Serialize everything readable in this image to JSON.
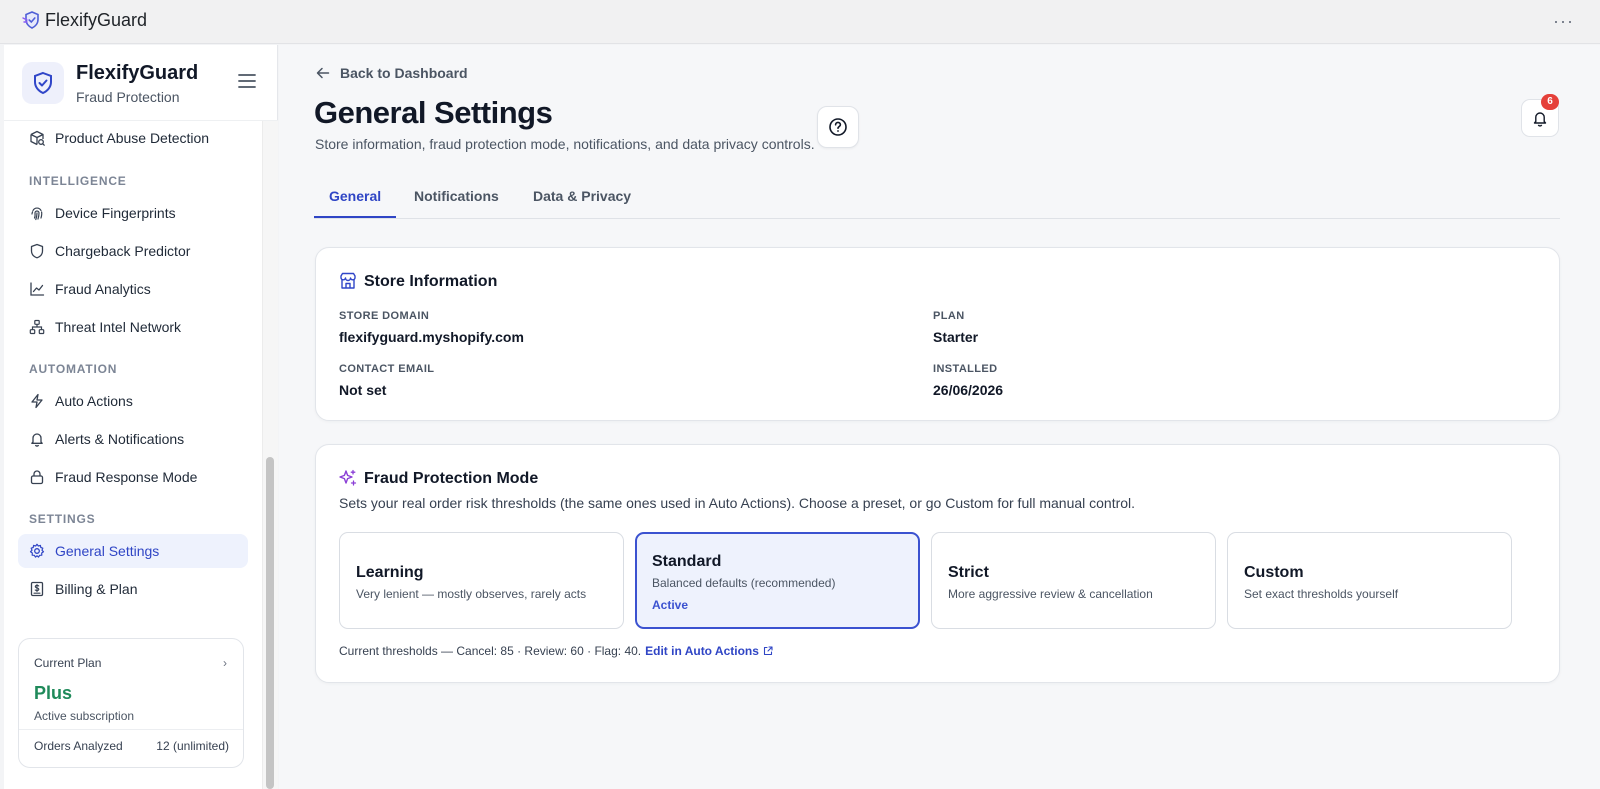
{
  "app": {
    "title": "FlexifyGuard",
    "more": "···"
  },
  "sidebar": {
    "brand": "FlexifyGuard",
    "subtitle": "Fraud Protection",
    "top_item": {
      "label": "Product Abuse Detection",
      "icon": "package-search-icon"
    },
    "sections": [
      {
        "title": "INTELLIGENCE",
        "items": [
          {
            "label": "Device Fingerprints",
            "icon": "fingerprint-icon"
          },
          {
            "label": "Chargeback Predictor",
            "icon": "shield-icon"
          },
          {
            "label": "Fraud Analytics",
            "icon": "line-chart-icon"
          },
          {
            "label": "Threat Intel Network",
            "icon": "network-icon"
          }
        ]
      },
      {
        "title": "AUTOMATION",
        "items": [
          {
            "label": "Auto Actions",
            "icon": "lightning-icon"
          },
          {
            "label": "Alerts & Notifications",
            "icon": "bell-icon"
          },
          {
            "label": "Fraud Response Mode",
            "icon": "lock-icon"
          }
        ]
      },
      {
        "title": "SETTINGS",
        "items": [
          {
            "label": "General Settings",
            "icon": "gear-icon",
            "active": true
          },
          {
            "label": "Billing & Plan",
            "icon": "receipt-icon"
          }
        ]
      }
    ],
    "plan_card": {
      "label": "Current Plan",
      "name": "Plus",
      "status": "Active subscription",
      "orders_label": "Orders Analyzed",
      "orders_value": "12 (unlimited)"
    }
  },
  "header": {
    "back_label": "Back to Dashboard",
    "title": "General Settings",
    "subtitle": "Store information, fraud protection mode, notifications, and data privacy controls.",
    "notification_count": "6"
  },
  "tabs": [
    {
      "label": "General",
      "active": true
    },
    {
      "label": "Notifications"
    },
    {
      "label": "Data & Privacy"
    }
  ],
  "store_info": {
    "title": "Store Information",
    "fields": [
      {
        "key": "STORE DOMAIN",
        "value": "flexifyguard.myshopify.com"
      },
      {
        "key": "PLAN",
        "value": "Starter"
      },
      {
        "key": "CONTACT EMAIL",
        "value": "Not set"
      },
      {
        "key": "INSTALLED",
        "value": "26/06/2026"
      }
    ]
  },
  "fraud_mode": {
    "title": "Fraud Protection Mode",
    "description": "Sets your real order risk thresholds (the same ones used in Auto Actions). Choose a preset, or go Custom for full manual control.",
    "modes": [
      {
        "name": "Learning",
        "description": "Very lenient — mostly observes, rarely acts"
      },
      {
        "name": "Standard",
        "description": "Balanced defaults (recommended)",
        "selected": true,
        "badge": "Active"
      },
      {
        "name": "Strict",
        "description": "More aggressive review & cancellation"
      },
      {
        "name": "Custom",
        "description": "Set exact thresholds yourself"
      }
    ],
    "thresholds_text": "Current thresholds — Cancel: 85 · Review: 60 · Flag: 40.",
    "edit_link": "Edit in Auto Actions"
  },
  "colors": {
    "accent": "#2f45c5",
    "plan_green": "#1f8a5a",
    "badge_red": "#e5403a"
  }
}
